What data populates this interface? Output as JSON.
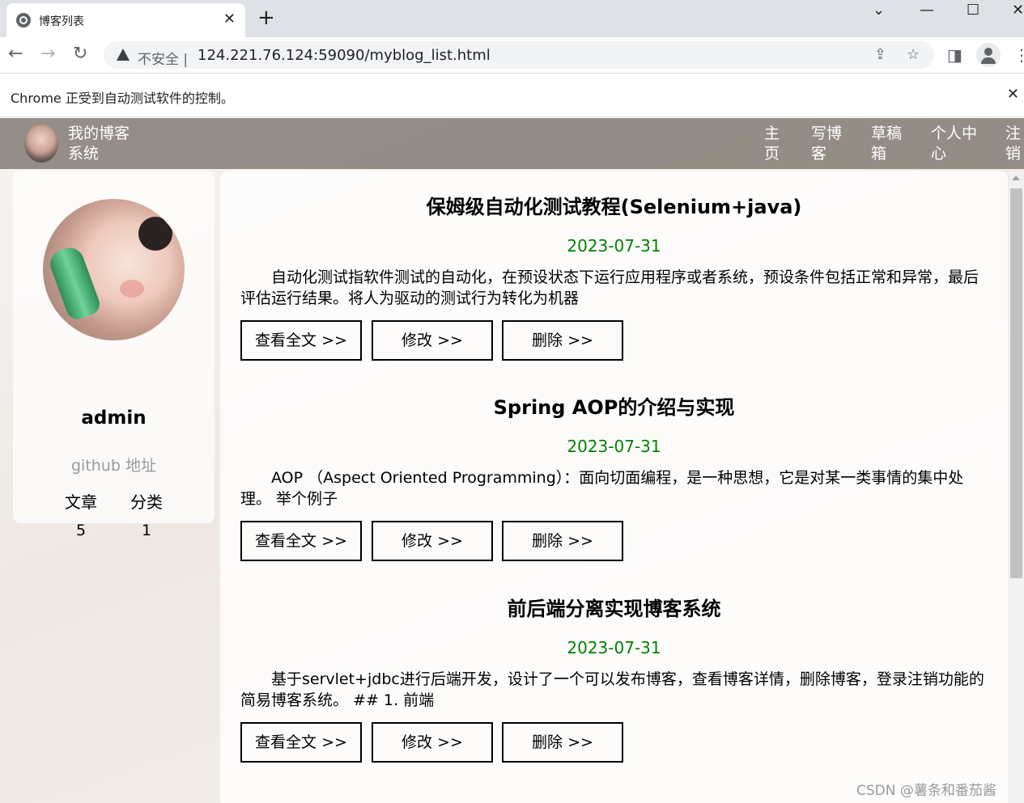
{
  "browser": {
    "tab_title": "博客列表",
    "tab_close": "✕",
    "new_tab": "+",
    "insecure_label": "不安全",
    "separator": "|",
    "url": "124.221.76.124:59090/myblog_list.html",
    "infobar_text": "Chrome 正受到自动测试软件的控制。",
    "infobar_close": "✕"
  },
  "site": {
    "title": "我的博客系统",
    "nav": [
      "主页",
      "写博客",
      "草稿箱",
      "个人中心",
      "注销"
    ]
  },
  "profile": {
    "username": "admin",
    "github_label": "github 地址",
    "stats": [
      {
        "label": "文章",
        "value": "5"
      },
      {
        "label": "分类",
        "value": "1"
      }
    ]
  },
  "posts": [
    {
      "title": "保姆级自动化测试教程(Selenium+java)",
      "date": "2023-07-31",
      "desc": "自动化测试指软件测试的自动化，在预设状态下运行应用程序或者系统，预设条件包括正常和异常，最后评估运行结果。将人为驱动的测试行为转化为机器",
      "buttons": [
        "查看全文 >>",
        "修改 >>",
        "删除 >>"
      ]
    },
    {
      "title": "Spring AOP的介绍与实现",
      "date": "2023-07-31",
      "desc": "AOP （Aspect Oriented Programming）：面向切面编程，是一种思想，它是对某一类事情的集中处理。 举个例子",
      "buttons": [
        "查看全文 >>",
        "修改 >>",
        "删除 >>"
      ]
    },
    {
      "title": "前后端分离实现博客系统",
      "date": "2023-07-31",
      "desc": "基于servlet+jdbc进行后端开发，设计了一个可以发布博客，查看博客详情，删除博客，登录注销功能的简易博客系统。 ## 1. 前端",
      "buttons": [
        "查看全文 >>",
        "修改 >>",
        "删除 >>"
      ]
    }
  ],
  "watermark": "CSDN @薯条和番茄酱"
}
